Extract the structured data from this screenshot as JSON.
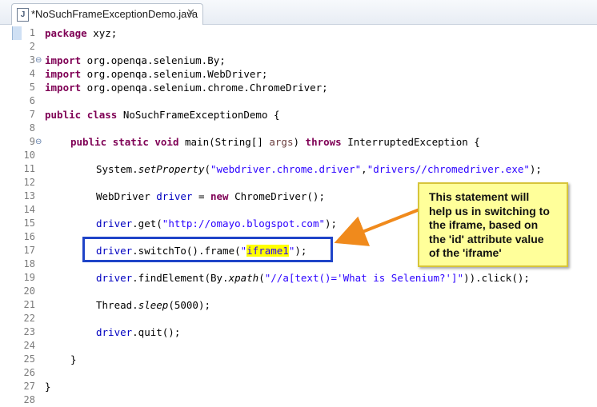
{
  "tab": {
    "icon": "java-file-icon",
    "title": "*NoSuchFrameExceptionDemo.java",
    "close": "✕"
  },
  "lines": [
    "1",
    "2",
    "3",
    "4",
    "5",
    "6",
    "7",
    "8",
    "9",
    "10",
    "11",
    "12",
    "13",
    "14",
    "15",
    "16",
    "17",
    "18",
    "19",
    "20",
    "21",
    "22",
    "23",
    "24",
    "25",
    "26",
    "27",
    "28"
  ],
  "code": {
    "l1": {
      "kw": "package",
      "rest": " xyz;"
    },
    "l3": {
      "kw": "import",
      "rest": " org.openqa.selenium.By;"
    },
    "l4": {
      "kw": "import",
      "rest": " org.openqa.selenium.WebDriver;"
    },
    "l5": {
      "kw": "import",
      "rest": " org.openqa.selenium.chrome.ChromeDriver;"
    },
    "l7": {
      "kw1": "public",
      "kw2": "class",
      "rest": " NoSuchFrameExceptionDemo {"
    },
    "l9": {
      "kw1": "public",
      "kw2": "static",
      "kw3": "void",
      "mid": " main(String[] ",
      "param": "args",
      "mid2": ") ",
      "kw4": "throws",
      "rest": " InterruptedException {"
    },
    "l11": {
      "a": "System.",
      "b": "setProperty",
      "c": "(",
      "s1": "\"webdriver.chrome.driver\"",
      "d": ",",
      "s2": "\"drivers//chromedriver.exe\"",
      "e": ");"
    },
    "l13": {
      "a": "WebDriver ",
      "v": "driver",
      "b": " = ",
      "kw": "new",
      "c": " ChromeDriver();"
    },
    "l15": {
      "v": "driver",
      "a": ".get(",
      "s": "\"http://omayo.blogspot.com\"",
      "b": ");"
    },
    "l17": {
      "v": "driver",
      "a": ".switchTo().frame(",
      "q1": "\"",
      "s": "iframe1",
      "q2": "\"",
      "b": ");"
    },
    "l19": {
      "v": "driver",
      "a": ".findElement(By.",
      "i": "xpath",
      "b": "(",
      "s": "\"//a[text()='What is Selenium?']\"",
      "c": ")).click();"
    },
    "l21": {
      "a": "Thread.",
      "i": "sleep",
      "b": "(5000);"
    },
    "l23": {
      "v": "driver",
      "a": ".quit();"
    },
    "l25": {
      "a": "}"
    },
    "l27": {
      "a": "}"
    }
  },
  "fold_icon": "⊖",
  "note": {
    "lines": [
      "This statement will",
      "help us in switching to",
      "the iframe, based on",
      "the 'id' attribute value",
      "of the 'iframe'"
    ]
  },
  "colors": {
    "keyword": "#7f0055",
    "string": "#2a00ff",
    "field": "#0000c0",
    "box": "#1f44c8",
    "arrow": "#f08a1c",
    "note_bg": "#ffff9a"
  }
}
